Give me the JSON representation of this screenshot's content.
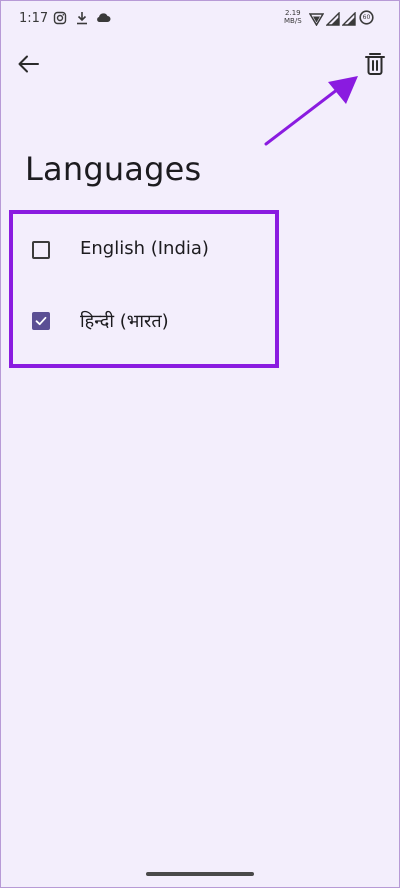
{
  "status_bar": {
    "time": "1:17",
    "net_speed_value": "2.19",
    "net_speed_unit": "MB/S",
    "battery": "60",
    "icons": [
      "instagram-icon",
      "download-icon",
      "cloud-icon",
      "wifi-icon",
      "signal-icon",
      "battery-icon"
    ]
  },
  "app_bar": {
    "back_icon": "arrow-left-icon",
    "delete_icon": "trash-icon"
  },
  "page": {
    "title": "Languages"
  },
  "languages": [
    {
      "label": "English (India)",
      "checked": false
    },
    {
      "label": "हिन्दी (भारत)",
      "checked": true
    }
  ],
  "colors": {
    "background": "#f3eefc",
    "accent": "#8a1be0",
    "checkbox_checked": "#5b4f94"
  }
}
